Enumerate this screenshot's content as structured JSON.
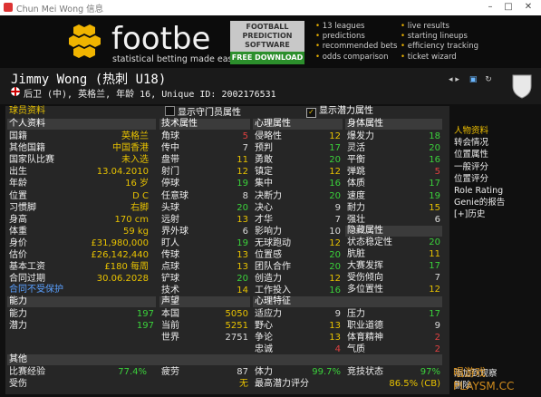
{
  "window": {
    "title": "Chun Mei Wong 信息"
  },
  "ad": {
    "brand": "footbe",
    "tagline": "statistical betting made easy",
    "pred_lines": [
      "FOOTBALL",
      "PREDICTION",
      "SOFTWARE"
    ],
    "download": "FREE DOWNLOAD",
    "features_left": [
      "13 leagues",
      "predictions",
      "recommended bets",
      "odds comparison"
    ],
    "features_right": [
      "live results",
      "starting lineups",
      "efficiency tracking",
      "ticket wizard"
    ],
    "colors": {
      "bullet": "#e8b000",
      "download_bg": "#2c8f2c"
    }
  },
  "player": {
    "name": "Jimmy Wong (热刺 U18)",
    "subtitle": "后卫 (中), 英格兰, 年龄 16, Unique ID: 2002176531"
  },
  "tab": {
    "label": "球员资料"
  },
  "toggles": {
    "gk": "显示守门员属性",
    "potential": "显示潜力属性"
  },
  "personal": {
    "header": "个人资料",
    "rows": [
      {
        "label": "国籍",
        "value": "英格兰"
      },
      {
        "label": "其他国籍",
        "value": "中国香港"
      },
      {
        "label": "国家队比赛",
        "value": "未入选"
      },
      {
        "label": "出生",
        "value": "13.04.2010"
      },
      {
        "label": "年龄",
        "value": "16 岁"
      },
      {
        "label": "位置",
        "value": "D C"
      },
      {
        "label": "习惯脚",
        "value": "右脚"
      },
      {
        "label": "身高",
        "value": "170 cm"
      },
      {
        "label": "体重",
        "value": "59 kg"
      },
      {
        "label": "身价",
        "value": "£31,980,000"
      },
      {
        "label": "估价",
        "value": "£26,142,440"
      },
      {
        "label": "基本工资",
        "value": "£180 每周"
      },
      {
        "label": "合同过期",
        "value": "30.06.2028"
      }
    ],
    "contract_link": "合同不受保护"
  },
  "ability": {
    "header": "能力",
    "rows": [
      {
        "label": "能力",
        "value": "197"
      },
      {
        "label": "潜力",
        "value": "197"
      }
    ]
  },
  "technical": {
    "header": "技术属性",
    "rows": [
      {
        "label": "角球",
        "value": "5"
      },
      {
        "label": "传中",
        "value": "7"
      },
      {
        "label": "盘带",
        "value": "11"
      },
      {
        "label": "射门",
        "value": "12"
      },
      {
        "label": "停球",
        "value": "19"
      },
      {
        "label": "任意球",
        "value": "8"
      },
      {
        "label": "头球",
        "value": "20"
      },
      {
        "label": "远射",
        "value": "13"
      },
      {
        "label": "界外球",
        "value": "6"
      },
      {
        "label": "盯人",
        "value": "19"
      },
      {
        "label": "传球",
        "value": "13"
      },
      {
        "label": "点球",
        "value": "13"
      },
      {
        "label": "铲球",
        "value": "20"
      },
      {
        "label": "技术",
        "value": "14"
      }
    ]
  },
  "mental": {
    "header": "心理属性",
    "rows": [
      {
        "label": "侵略性",
        "value": "12"
      },
      {
        "label": "预判",
        "value": "17"
      },
      {
        "label": "勇敢",
        "value": "20"
      },
      {
        "label": "镇定",
        "value": "12"
      },
      {
        "label": "集中",
        "value": "16"
      },
      {
        "label": "决断力",
        "value": "20"
      },
      {
        "label": "决心",
        "value": "9"
      },
      {
        "label": "才华",
        "value": "7"
      },
      {
        "label": "影响力",
        "value": "10"
      },
      {
        "label": "无球跑动",
        "value": "12"
      },
      {
        "label": "位置感",
        "value": "20"
      },
      {
        "label": "团队合作",
        "value": "20"
      },
      {
        "label": "创造力",
        "value": "12"
      },
      {
        "label": "工作投入",
        "value": "16"
      }
    ]
  },
  "physical": {
    "header": "身体属性",
    "rows": [
      {
        "label": "爆发力",
        "value": "18"
      },
      {
        "label": "灵活",
        "value": "20"
      },
      {
        "label": "平衡",
        "value": "16"
      },
      {
        "label": "弹跳",
        "value": "5"
      },
      {
        "label": "体质",
        "value": "17"
      },
      {
        "label": "速度",
        "value": "19"
      },
      {
        "label": "耐力",
        "value": "15"
      },
      {
        "label": "强壮",
        "value": "6"
      }
    ]
  },
  "hidden": {
    "header": "隐藏属性",
    "rows": [
      {
        "label": "状态稳定性",
        "value": "20"
      },
      {
        "label": "肮脏",
        "value": "11"
      },
      {
        "label": "大赛发挥",
        "value": "17"
      },
      {
        "label": "受伤倾向",
        "value": "7"
      },
      {
        "label": "多位置性",
        "value": "12"
      }
    ]
  },
  "reputation": {
    "header": "声望",
    "rows": [
      {
        "label": "本国",
        "value": "5050"
      },
      {
        "label": "当前",
        "value": "5251"
      },
      {
        "label": "世界",
        "value": "2751"
      }
    ]
  },
  "traits": {
    "header": "心理特征",
    "rows_left": [
      {
        "label": "适应力",
        "value": "9"
      },
      {
        "label": "野心",
        "value": "13"
      },
      {
        "label": "争论",
        "value": "13"
      },
      {
        "label": "忠诚",
        "value": "4"
      }
    ],
    "rows_right": [
      {
        "label": "压力",
        "value": "17"
      },
      {
        "label": "职业道德",
        "value": "9"
      },
      {
        "label": "体育精神",
        "value": "2"
      },
      {
        "label": "气质",
        "value": "2"
      }
    ]
  },
  "other": {
    "header": "其他",
    "match_exp_label": "比赛经验",
    "match_exp_value": "77.4%",
    "injury_label": "受伤",
    "fatigue_label": "疲劳",
    "fatigue_value": "87",
    "ill_label": "无",
    "stamina_label": "体力",
    "stamina_value": "99.7%",
    "best_potential_label": "最高潜力评分",
    "best_potential_value": "86.5% (CB)",
    "condition_label": "竞技状态",
    "condition_value": "97%"
  },
  "rightnav": {
    "items": [
      "人物资料",
      "转会情况",
      "位置属性",
      "一般评分",
      "位置评分",
      "Role Rating",
      "Genie的报告",
      "[+]历史"
    ],
    "bottom": [
      "添加到观察",
      "删除"
    ]
  },
  "watermark": "唱游戏 PLAYSM.CC"
}
